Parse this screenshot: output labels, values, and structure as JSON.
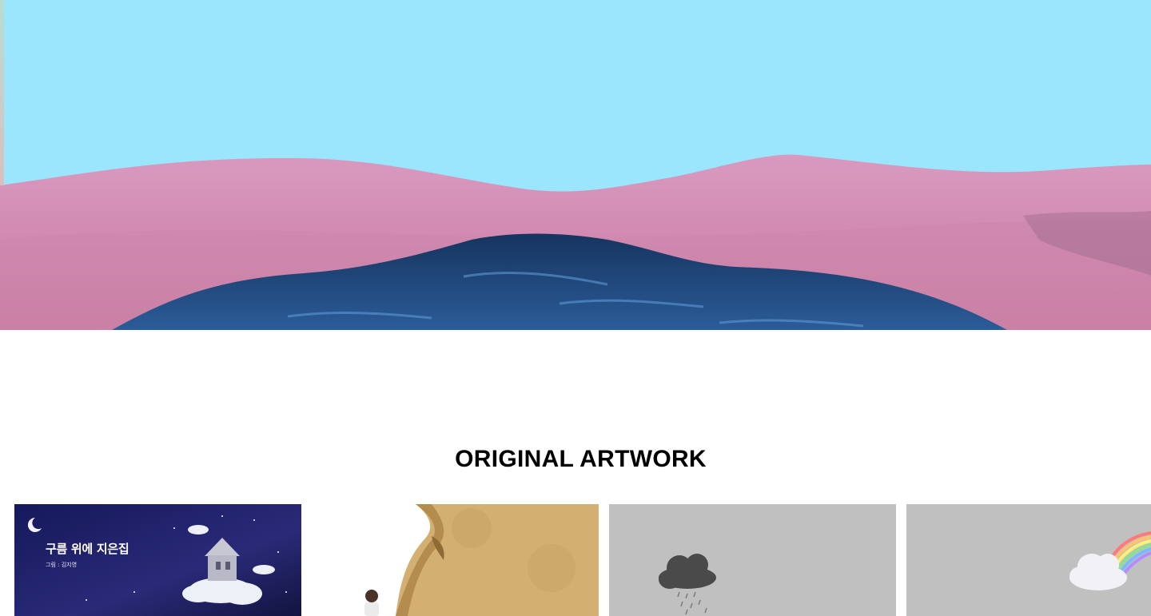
{
  "hero": {
    "image": "pink-grass-hills-with-blue-pond",
    "sky_color": "#9be6fd",
    "grass_color": "#d88fb3",
    "water_color": "#1d3f78"
  },
  "section": {
    "title": "ORIGINAL ARTWORK"
  },
  "artworks": [
    {
      "image": "night-sky-cloud-house",
      "title": "구름 위에 지은집",
      "credit": "그림 : 김지영"
    },
    {
      "image": "woman-and-curled-paper"
    },
    {
      "image": "rain-cloud"
    },
    {
      "image": "cloud-with-rainbow"
    }
  ]
}
